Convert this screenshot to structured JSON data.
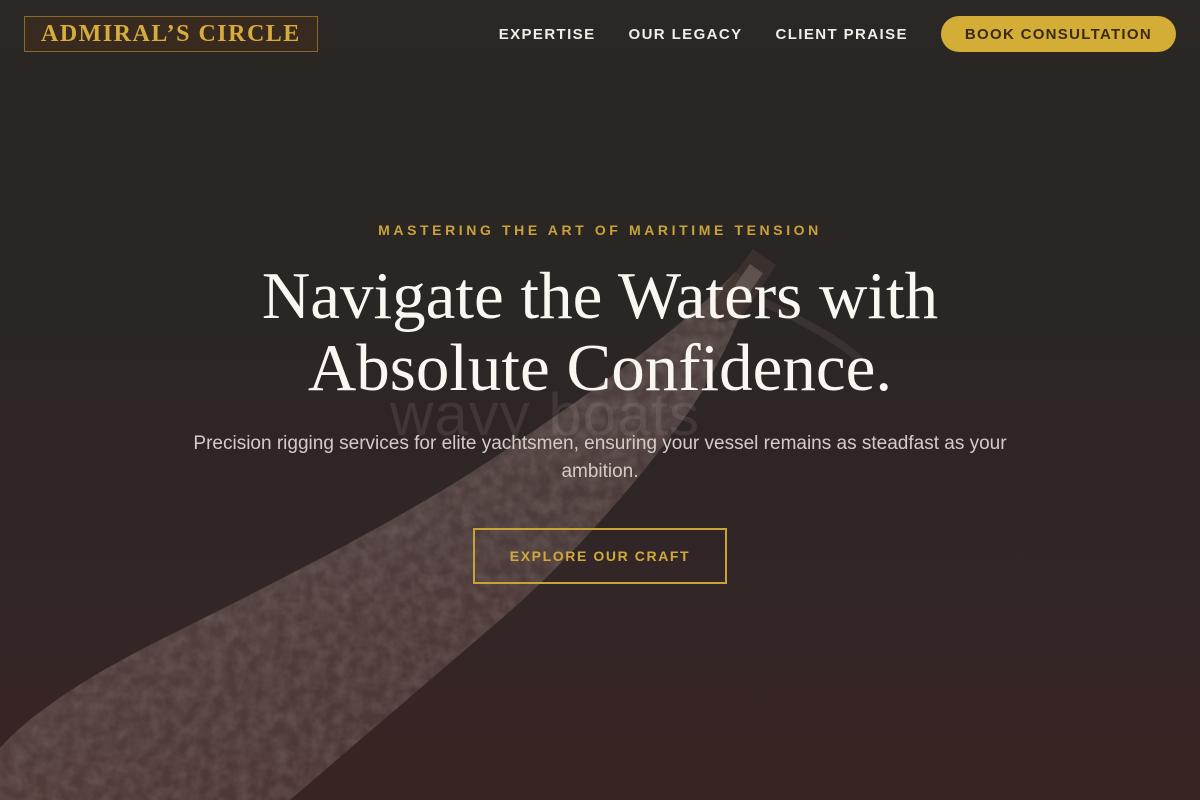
{
  "brand": {
    "name": "ADMIRAL’S CIRCLE"
  },
  "nav": {
    "links": [
      "EXPERTISE",
      "OUR LEGACY",
      "CLIENT PRAISE"
    ],
    "cta": "BOOK CONSULTATION"
  },
  "hero": {
    "eyebrow": "MASTERING THE ART OF MARITIME TENSION",
    "headline_line1": "Navigate the Waters with",
    "headline_line2": "Absolute Confidence.",
    "subtext": "Precision rigging services for elite yachtsmen, ensuring your vessel remains as steadfast as your ambition.",
    "button": "EXPLORE OUR CRAFT",
    "background_watermark": "wavy boats"
  },
  "colors": {
    "gold": "#d4ad36",
    "background": "#2a2522",
    "text": "#f3ede2"
  }
}
